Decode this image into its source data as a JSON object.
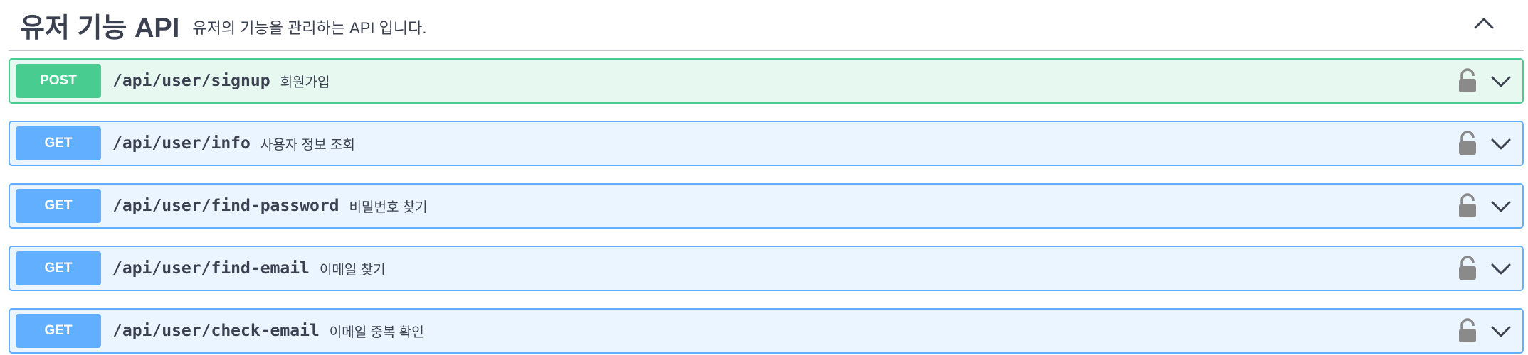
{
  "tag": {
    "title": "유저 기능 API",
    "description": "유저의 기능을 관리하는 API 입니다."
  },
  "operations": [
    {
      "method": "POST",
      "path": "/api/user/signup",
      "summary": "회원가입"
    },
    {
      "method": "GET",
      "path": "/api/user/info",
      "summary": "사용자 정보 조회"
    },
    {
      "method": "GET",
      "path": "/api/user/find-password",
      "summary": "비밀번호 찾기"
    },
    {
      "method": "GET",
      "path": "/api/user/find-email",
      "summary": "이메일 찾기"
    },
    {
      "method": "GET",
      "path": "/api/user/check-email",
      "summary": "이메일 중복 확인"
    }
  ],
  "icons": {
    "collapse": "chevron-up-icon",
    "lock": "unlocked-lock-icon",
    "expand": "chevron-down-icon"
  },
  "colors": {
    "post": "#49cc90",
    "get": "#61affe",
    "text": "#3b4151",
    "icon": "#8a8a8a"
  }
}
